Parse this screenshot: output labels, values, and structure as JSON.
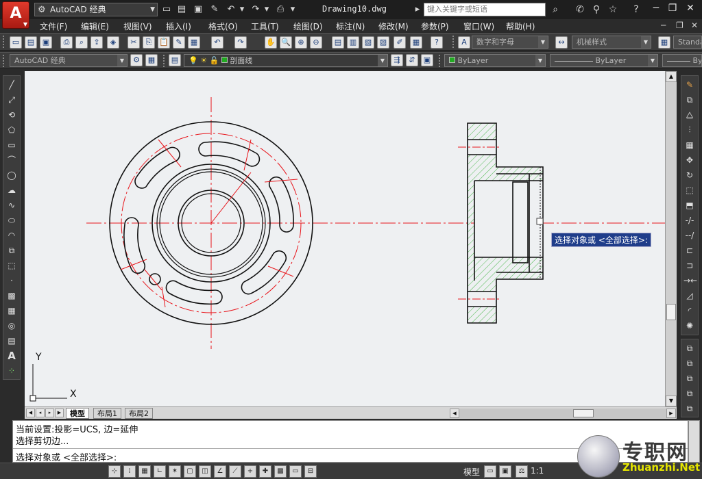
{
  "titlebar": {
    "logo": "A",
    "workspace": "AutoCAD 经典",
    "document_title": "Drawing10.dwg",
    "search_placeholder": "键入关键字或短语",
    "help_label": "?"
  },
  "menus": [
    {
      "label": "文件(F)"
    },
    {
      "label": "编辑(E)"
    },
    {
      "label": "视图(V)"
    },
    {
      "label": "插入(I)"
    },
    {
      "label": "格式(O)"
    },
    {
      "label": "工具(T)"
    },
    {
      "label": "绘图(D)"
    },
    {
      "label": "标注(N)"
    },
    {
      "label": "修改(M)"
    },
    {
      "label": "参数(P)"
    },
    {
      "label": "窗口(W)"
    },
    {
      "label": "帮助(H)"
    }
  ],
  "toolbar1": {
    "text_style": "数字和字母",
    "dim_style": "机械样式",
    "table_style": "Standard"
  },
  "toolbar2": {
    "workspace": "AutoCAD 经典",
    "layer": "剖面线",
    "color": "ByLayer",
    "linetype": "ByLayer",
    "lineweight": "ByLayer"
  },
  "drawing": {
    "ucs_x_label": "X",
    "ucs_y_label": "Y",
    "tooltip": "选择对象或 <全部选择>:",
    "colors": {
      "object": "#111111",
      "centerline": "#e8141a",
      "hatch": "#22aa22",
      "background": "#eef0f2"
    }
  },
  "layout_tabs": [
    {
      "label": "模型",
      "active": true
    },
    {
      "label": "布局1",
      "active": false
    },
    {
      "label": "布局2",
      "active": false
    }
  ],
  "command": {
    "line1": "当前设置:投影=UCS, 边=延伸",
    "line2": "选择剪切边...",
    "prompt": "选择对象或 <全部选择>:"
  },
  "statusbar": {
    "model_label": "模型",
    "scale": "1:1"
  },
  "watermark": {
    "text": "专职网",
    "url": "Zhuanzhi.Net"
  }
}
